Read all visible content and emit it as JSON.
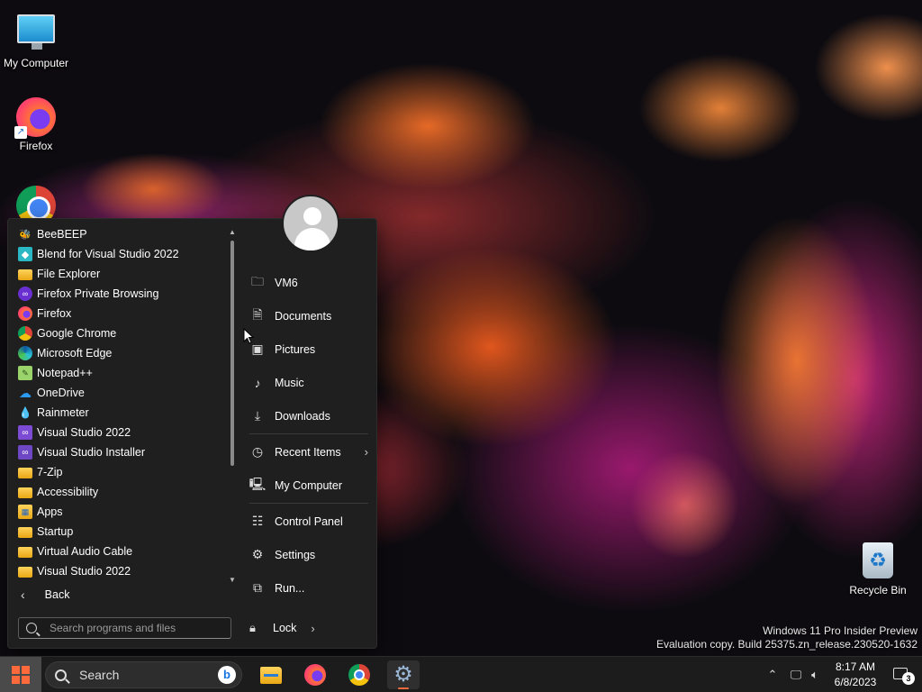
{
  "desktop": {
    "icons": [
      {
        "label": "My Computer",
        "icon": "monitor-icon"
      },
      {
        "label": "Firefox",
        "icon": "firefox-icon"
      },
      {
        "label": "",
        "icon": "chrome-icon"
      }
    ],
    "recycle_bin": {
      "label": "Recycle Bin",
      "icon": "recycle-bin-icon"
    },
    "watermark": {
      "line1": "Windows 11 Pro Insider Preview",
      "line2": "Evaluation copy. Build 25375.zn_release.230520-1632"
    }
  },
  "start_menu": {
    "programs": [
      {
        "label": "BeeBEEP",
        "icon": "beebeep-icon"
      },
      {
        "label": "Blend for Visual Studio 2022",
        "icon": "blend-icon"
      },
      {
        "label": "File Explorer",
        "icon": "folder-icon"
      },
      {
        "label": "Firefox Private Browsing",
        "icon": "firefox-private-icon"
      },
      {
        "label": "Firefox",
        "icon": "firefox-icon"
      },
      {
        "label": "Google Chrome",
        "icon": "chrome-icon"
      },
      {
        "label": "Microsoft Edge",
        "icon": "edge-icon"
      },
      {
        "label": "Notepad++",
        "icon": "notepadpp-icon"
      },
      {
        "label": "OneDrive",
        "icon": "cloud-icon"
      },
      {
        "label": "Rainmeter",
        "icon": "rainmeter-icon"
      },
      {
        "label": "Visual Studio 2022",
        "icon": "visual-studio-icon"
      },
      {
        "label": "Visual Studio Installer",
        "icon": "visual-studio-installer-icon"
      },
      {
        "label": "7-Zip",
        "icon": "folder-icon"
      },
      {
        "label": "Accessibility",
        "icon": "folder-icon"
      },
      {
        "label": "Apps",
        "icon": "apps-icon"
      },
      {
        "label": "Startup",
        "icon": "folder-icon"
      },
      {
        "label": "Virtual Audio Cable",
        "icon": "folder-icon"
      },
      {
        "label": "Visual Studio 2022",
        "icon": "folder-icon"
      }
    ],
    "back_label": "Back",
    "search_placeholder": "Search programs and files",
    "places": [
      {
        "label": "VM6",
        "icon": "user-folder-icon",
        "chevron": false
      },
      {
        "label": "Documents",
        "icon": "document-icon",
        "chevron": false
      },
      {
        "label": "Pictures",
        "icon": "picture-icon",
        "chevron": false
      },
      {
        "label": "Music",
        "icon": "music-icon",
        "chevron": false
      },
      {
        "label": "Downloads",
        "icon": "download-icon",
        "chevron": false
      },
      {
        "label": "Recent Items",
        "icon": "clock-icon",
        "chevron": true
      },
      {
        "label": "My Computer",
        "icon": "computer-icon",
        "chevron": false
      },
      {
        "label": "Control Panel",
        "icon": "control-panel-icon",
        "chevron": false
      },
      {
        "label": "Settings",
        "icon": "gear-icon",
        "chevron": false
      },
      {
        "label": "Run...",
        "icon": "run-icon",
        "chevron": false
      }
    ],
    "lock_label": "Lock"
  },
  "taskbar": {
    "search_label": "Search",
    "apps": [
      {
        "name": "File Explorer",
        "icon": "folder-icon"
      },
      {
        "name": "Firefox",
        "icon": "firefox-icon"
      },
      {
        "name": "Google Chrome",
        "icon": "chrome-icon"
      },
      {
        "name": "Settings",
        "icon": "gear-icon"
      }
    ],
    "clock": {
      "time": "8:17 AM",
      "date": "6/8/2023"
    },
    "notification_count": "3"
  },
  "colors": {
    "accent": "#ff6a3d",
    "menu_bg": "#1f1f1f",
    "taskbar_bg": "#1c1c1c"
  }
}
